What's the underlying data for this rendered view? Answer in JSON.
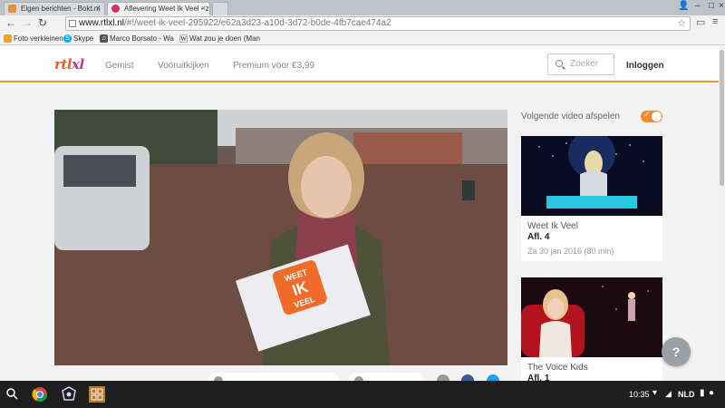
{
  "browser": {
    "tabs": [
      {
        "title": "Eigen berichten - Bokt.nl",
        "active": false
      },
      {
        "title": "Aflevering Weet Ik Veel - z",
        "active": true
      }
    ],
    "url_domain": "www.rtlxl.nl",
    "url_path": "/#!/weet-ik-veel-295922/e62a3d23-a10d-3d72-b0de-4fb7cae474a2",
    "bookmarks": [
      "Foto verkleinen",
      "Skype",
      "Marco Borsato - Wa",
      "Wat zou je doen (Man"
    ]
  },
  "site": {
    "logo": {
      "a": "rtl",
      "b": "xl"
    },
    "nav": [
      "Gemist",
      "Vooruitkijken",
      "Premium voor €3,99"
    ],
    "search_placeholder": "Zoeker",
    "login": "Inloggen",
    "accent_color": "#f39425"
  },
  "video": {
    "sign_text": [
      "WEET",
      "IK",
      "VEEL"
    ]
  },
  "sidebar": {
    "autoplay_label": "Volgende video afspelen",
    "autoplay_on": true,
    "cards": [
      {
        "title": "Weet Ik Veel",
        "episode": "Afl. 4",
        "date": "Za 30 jan 2016 (80 min)"
      },
      {
        "title": "The Voice Kids",
        "episode": "Afl. 1",
        "date": ""
      }
    ]
  },
  "help_button": "?",
  "shelf": {
    "time": "10:35",
    "lang": "NLD"
  }
}
